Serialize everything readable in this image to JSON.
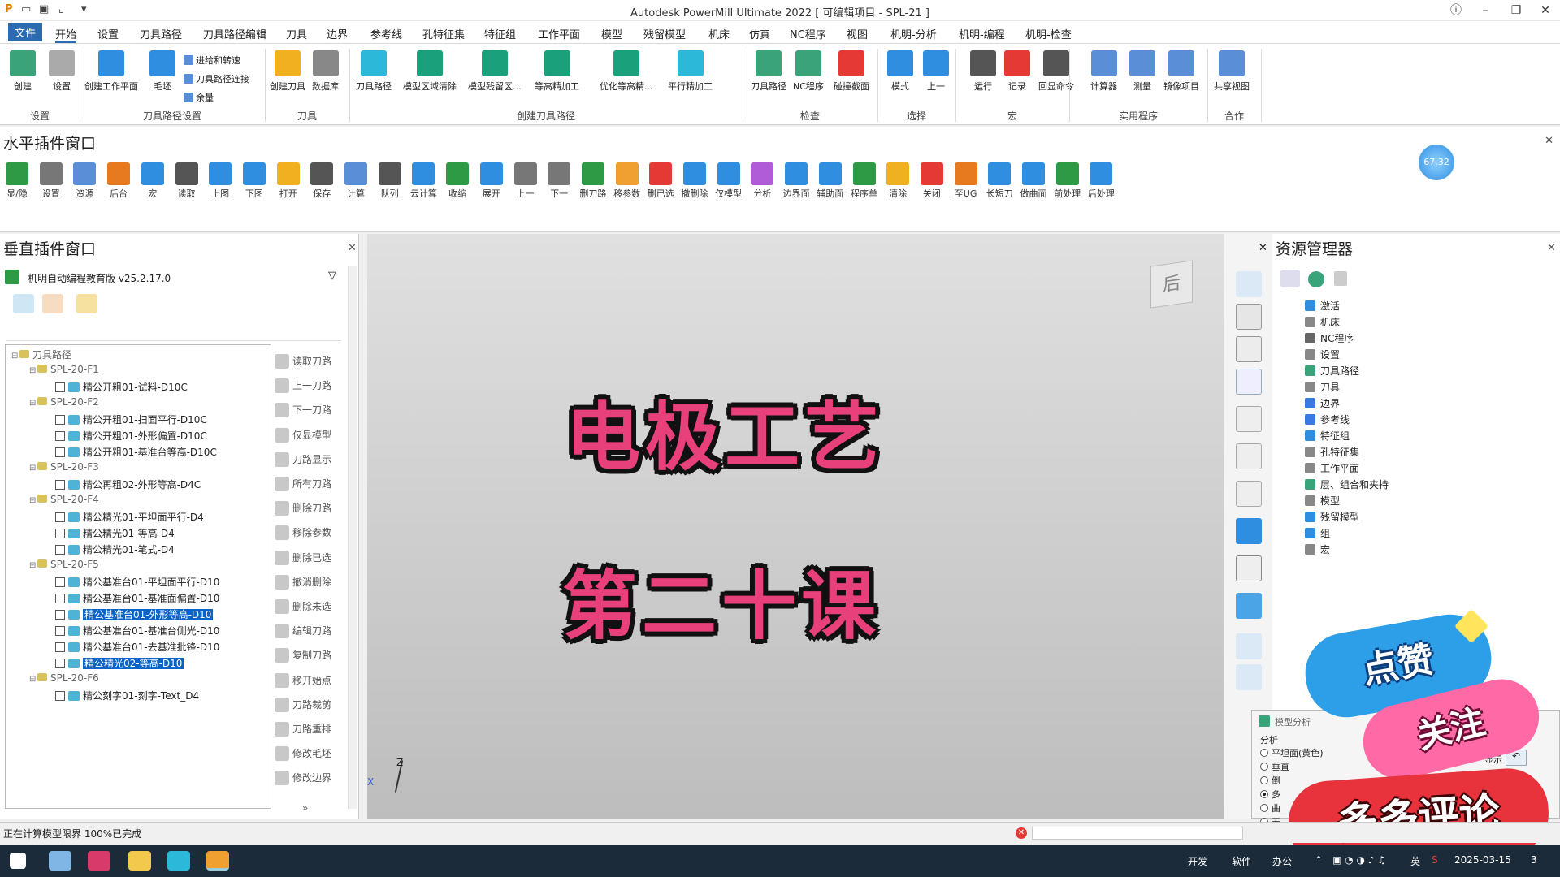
{
  "window": {
    "title": "Autodesk PowerMill Ultimate 2022    [ 可编辑项目 - SPL-21 ]"
  },
  "menu": [
    "文件",
    "开始",
    "设置",
    "刀具路径",
    "刀具路径编辑",
    "刀具",
    "边界",
    "参考线",
    "孔特征集",
    "特征组",
    "工作平面",
    "模型",
    "残留模型",
    "机床",
    "仿真",
    "NC程序",
    "视图",
    "机明-分析",
    "机明-编程",
    "机明-检查"
  ],
  "ribbon": {
    "buttons": [
      "创建",
      "设置",
      "创建工作平面",
      "毛坯",
      "创建刀具",
      "数据库",
      "刀具路径",
      "模型区域清除",
      "模型残留区...",
      "等高精加工",
      "优化等高精...",
      "平行精加工",
      "刀具路径",
      "NC程序",
      "碰撞截面",
      "模式",
      "上一",
      "运行",
      "记录",
      "回显命令",
      "计算器",
      "测量",
      "镜像项目",
      "共享视图"
    ],
    "small": [
      "进给和转速",
      "刀具路径连接",
      "余量"
    ],
    "groups": [
      "设置",
      "刀具路径设置",
      "刀具",
      "创建刀具路径",
      "检查",
      "选择",
      "宏",
      "实用程序",
      "合作"
    ]
  },
  "hplug": {
    "title": "水平插件窗口",
    "buttons": [
      "显/隐",
      "设置",
      "资源",
      "后台",
      "宏",
      "读取",
      "上图",
      "下图",
      "打开",
      "保存",
      "计算",
      "队列",
      "云计算",
      "收缩",
      "展开",
      "上一",
      "下一",
      "删刀路",
      "移参数",
      "删已选",
      "撤删除",
      "仅模型",
      "分析",
      "边界面",
      "辅助面",
      "程序单",
      "清除",
      "关闭",
      "至UG",
      "长短刀",
      "做曲面",
      "前处理",
      "后处理"
    ],
    "badge": "67.32"
  },
  "vplug": {
    "title": "垂直插件窗口",
    "plugin_name": "机明自动编程教育版 v25.2.17.0",
    "tree": [
      {
        "t": "刀具路径",
        "lvl": 0,
        "g": true
      },
      {
        "t": "SPL-20-F1",
        "lvl": 1,
        "g": true
      },
      {
        "t": "精公开粗01-试料-D10C",
        "lvl": 2
      },
      {
        "t": "SPL-20-F2",
        "lvl": 1,
        "g": true
      },
      {
        "t": "精公开粗01-扫面平行-D10C",
        "lvl": 2
      },
      {
        "t": "精公开粗01-外形偏置-D10C",
        "lvl": 2
      },
      {
        "t": "精公开粗01-基准台等高-D10C",
        "lvl": 2
      },
      {
        "t": "SPL-20-F3",
        "lvl": 1,
        "g": true
      },
      {
        "t": "精公再粗02-外形等高-D4C",
        "lvl": 2
      },
      {
        "t": "SPL-20-F4",
        "lvl": 1,
        "g": true
      },
      {
        "t": "精公精光01-平坦面平行-D4",
        "lvl": 2
      },
      {
        "t": "精公精光01-等高-D4",
        "lvl": 2
      },
      {
        "t": "精公精光01-笔式-D4",
        "lvl": 2
      },
      {
        "t": "SPL-20-F5",
        "lvl": 1,
        "g": true
      },
      {
        "t": "精公基准台01-平坦面平行-D10",
        "lvl": 2
      },
      {
        "t": "精公基准台01-基准面偏置-D10",
        "lvl": 2
      },
      {
        "t": "精公基准台01-外形等高-D10",
        "lvl": 2,
        "s": true
      },
      {
        "t": "精公基准台01-基准台侧光-D10",
        "lvl": 2
      },
      {
        "t": "精公基准台01-去基准批锋-D10",
        "lvl": 2
      },
      {
        "t": "精公精光02-等高-D10",
        "lvl": 2,
        "s": true
      },
      {
        "t": "SPL-20-F6",
        "lvl": 1,
        "g": true
      },
      {
        "t": "精公刻字01-刻字-Text_D4",
        "lvl": 2
      }
    ],
    "side_buttons": [
      "读取刀路",
      "上一刀路",
      "下一刀路",
      "仅显模型",
      "刀路显示",
      "所有刀路",
      "删除刀路",
      "移除参数",
      "删除已选",
      "撤消删除",
      "删除未选",
      "编辑刀路",
      "复制刀路",
      "移开始点",
      "刀路裁剪",
      "刀路重排",
      "修改毛坯",
      "修改边界"
    ],
    "more": "»"
  },
  "viewport": {
    "line1": "电极工艺",
    "line2": "第二十课",
    "cube_face": "后",
    "axis_z": "Z",
    "axis_x": "X"
  },
  "resmgr": {
    "title": "资源管理器",
    "items": [
      "激活",
      "机床",
      "NC程序",
      "设置",
      "刀具路径",
      "刀具",
      "边界",
      "参考线",
      "特征组",
      "孔特征集",
      "工作平面",
      "层、组合和夹持",
      "模型",
      "残留模型",
      "组",
      "宏"
    ]
  },
  "model_analysis": {
    "title": "模型分析",
    "label": "分析",
    "options": [
      "平坦面(黄色)",
      "垂直",
      "倒",
      "多",
      "曲",
      "无"
    ],
    "show": "显示"
  },
  "stickers": {
    "like": "点赞",
    "follow": "关注",
    "comment": "多多评论"
  },
  "status": {
    "text": "正在计算模型限界 100%已完成"
  },
  "taskbar": {
    "labels": [
      "开发",
      "软件",
      "办公"
    ],
    "ime": "英",
    "date": "2025-03-15",
    "notif": "3"
  }
}
